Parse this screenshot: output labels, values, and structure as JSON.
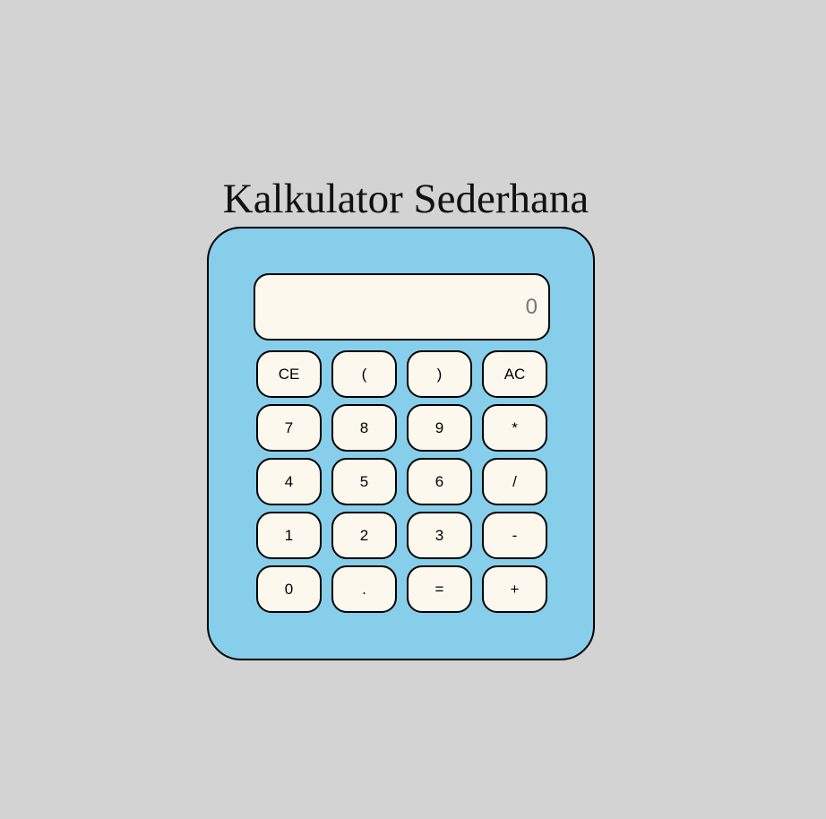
{
  "app": {
    "title": "Kalkulator Sederhana"
  },
  "display": {
    "value": "",
    "placeholder": "0"
  },
  "keys": [
    {
      "label": "CE",
      "name": "clear-entry-button"
    },
    {
      "label": "(",
      "name": "open-paren-button"
    },
    {
      "label": ")",
      "name": "close-paren-button"
    },
    {
      "label": "AC",
      "name": "all-clear-button"
    },
    {
      "label": "7",
      "name": "digit-7-button"
    },
    {
      "label": "8",
      "name": "digit-8-button"
    },
    {
      "label": "9",
      "name": "digit-9-button"
    },
    {
      "label": "*",
      "name": "multiply-button"
    },
    {
      "label": "4",
      "name": "digit-4-button"
    },
    {
      "label": "5",
      "name": "digit-5-button"
    },
    {
      "label": "6",
      "name": "digit-6-button"
    },
    {
      "label": "/",
      "name": "divide-button"
    },
    {
      "label": "1",
      "name": "digit-1-button"
    },
    {
      "label": "2",
      "name": "digit-2-button"
    },
    {
      "label": "3",
      "name": "digit-3-button"
    },
    {
      "label": "-",
      "name": "subtract-button"
    },
    {
      "label": "0",
      "name": "digit-0-button"
    },
    {
      "label": ".",
      "name": "decimal-point-button"
    },
    {
      "label": "=",
      "name": "equals-button"
    },
    {
      "label": "+",
      "name": "add-button"
    }
  ],
  "colors": {
    "page_background": "#d3d3d3",
    "calculator_body": "#87ceeb",
    "key_background": "#fdf8ee",
    "border": "#000000",
    "placeholder_text": "#777777"
  }
}
